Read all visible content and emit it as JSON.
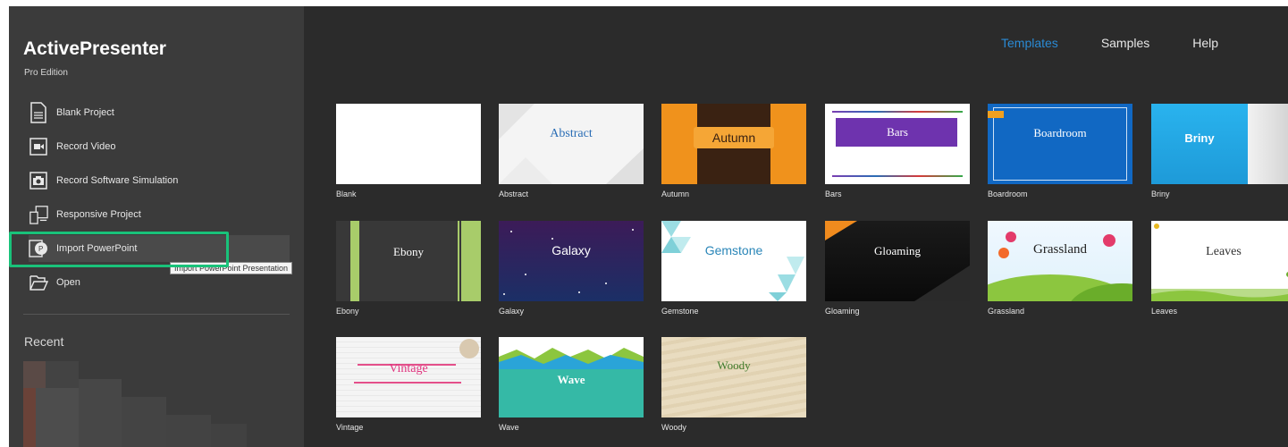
{
  "app": {
    "title": "ActivePresenter",
    "edition": "Pro Edition"
  },
  "sidebar": {
    "items": [
      {
        "label": "Blank Project",
        "icon": "blank-project-icon"
      },
      {
        "label": "Record Video",
        "icon": "record-video-icon"
      },
      {
        "label": "Record Software Simulation",
        "icon": "camera-icon"
      },
      {
        "label": "Responsive Project",
        "icon": "responsive-devices-icon"
      },
      {
        "label": "Import PowerPoint",
        "icon": "powerpoint-icon"
      },
      {
        "label": "Open",
        "icon": "folder-open-icon"
      }
    ],
    "tooltip": "Import PowerPoint Presentation",
    "recent_title": "Recent"
  },
  "nav": {
    "tabs": [
      "Templates",
      "Samples",
      "Help"
    ],
    "active": "Templates"
  },
  "templates": [
    {
      "label": "Blank",
      "thumb_text": ""
    },
    {
      "label": "Abstract",
      "thumb_text": "Abstract"
    },
    {
      "label": "Autumn",
      "thumb_text": "Autumn"
    },
    {
      "label": "Bars",
      "thumb_text": "Bars"
    },
    {
      "label": "Boardroom",
      "thumb_text": "Boardroom"
    },
    {
      "label": "Briny",
      "thumb_text": "Briny"
    },
    {
      "label": "Ebony",
      "thumb_text": "Ebony"
    },
    {
      "label": "Galaxy",
      "thumb_text": "Galaxy"
    },
    {
      "label": "Gemstone",
      "thumb_text": "Gemstone"
    },
    {
      "label": "Gloaming",
      "thumb_text": "Gloaming"
    },
    {
      "label": "Grassland",
      "thumb_text": "Grassland"
    },
    {
      "label": "Leaves",
      "thumb_text": "Leaves"
    },
    {
      "label": "Vintage",
      "thumb_text": "Vintage"
    },
    {
      "label": "Wave",
      "thumb_text": "Wave"
    },
    {
      "label": "Woody",
      "thumb_text": "Woody"
    }
  ],
  "colors": {
    "accent": "#2a8ad4",
    "highlight": "#19c27a",
    "sidebar": "#3b3b3b",
    "main": "#2b2b2b"
  }
}
